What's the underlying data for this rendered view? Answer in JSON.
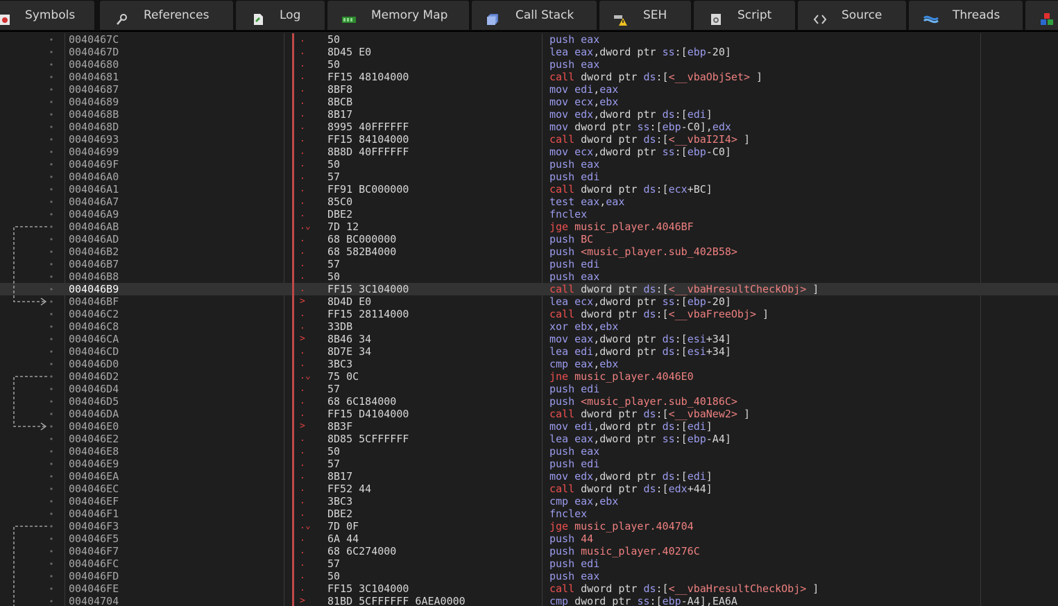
{
  "tabs": [
    {
      "label": "Symbols",
      "icon": "symbols-icon"
    },
    {
      "label": "References",
      "icon": "references-icon"
    },
    {
      "label": "Log",
      "icon": "log-icon"
    },
    {
      "label": "Memory Map",
      "icon": "memory-map-icon"
    },
    {
      "label": "Call Stack",
      "icon": "call-stack-icon"
    },
    {
      "label": "SEH",
      "icon": "seh-icon"
    },
    {
      "label": "Script",
      "icon": "script-icon"
    },
    {
      "label": "Source",
      "icon": "source-icon"
    },
    {
      "label": "Threads",
      "icon": "threads-icon"
    },
    {
      "label": "",
      "icon": "handles-icon"
    }
  ],
  "colors": {
    "background": "#1e1e1e",
    "mnemonic": "#9c9cf0",
    "call_jump": "#f05050",
    "symbol": "#f08080",
    "text": "#d8d8d8",
    "address": "#a8a8a8",
    "selected_row": "#333333",
    "eip_bar": "#c04848"
  },
  "disassembly": [
    {
      "addr": "0040467C",
      "mark": ".",
      "bytes": "50",
      "instr": [
        [
          "mn",
          "push "
        ],
        [
          "reg",
          "eax"
        ]
      ]
    },
    {
      "addr": "0040467D",
      "mark": ".",
      "bytes": "8D45 E0",
      "instr": [
        [
          "mn",
          "lea "
        ],
        [
          "reg",
          "eax"
        ],
        [
          "txt",
          ",dword ptr "
        ],
        [
          "seg",
          "ss"
        ],
        [
          "txt",
          ":["
        ],
        [
          "reg",
          "ebp"
        ],
        [
          "txt",
          "-20]"
        ]
      ]
    },
    {
      "addr": "00404680",
      "mark": ".",
      "bytes": "50",
      "instr": [
        [
          "mn",
          "push "
        ],
        [
          "reg",
          "eax"
        ]
      ]
    },
    {
      "addr": "00404681",
      "mark": ".",
      "bytes": "FF15 48104000",
      "instr": [
        [
          "call",
          "call "
        ],
        [
          "txt",
          "dword ptr "
        ],
        [
          "seg",
          "ds"
        ],
        [
          "txt",
          ":["
        ],
        [
          "sym",
          "<__vbaObjSet>"
        ],
        [
          "txt",
          " ]"
        ]
      ]
    },
    {
      "addr": "00404687",
      "mark": ".",
      "bytes": "8BF8",
      "instr": [
        [
          "mn",
          "mov "
        ],
        [
          "reg",
          "edi"
        ],
        [
          "txt",
          ","
        ],
        [
          "reg",
          "eax"
        ]
      ]
    },
    {
      "addr": "00404689",
      "mark": ".",
      "bytes": "8BCB",
      "instr": [
        [
          "mn",
          "mov "
        ],
        [
          "reg",
          "ecx"
        ],
        [
          "txt",
          ","
        ],
        [
          "reg",
          "ebx"
        ]
      ]
    },
    {
      "addr": "0040468B",
      "mark": ".",
      "bytes": "8B17",
      "instr": [
        [
          "mn",
          "mov "
        ],
        [
          "reg",
          "edx"
        ],
        [
          "txt",
          ",dword ptr "
        ],
        [
          "seg",
          "ds"
        ],
        [
          "txt",
          ":["
        ],
        [
          "reg",
          "edi"
        ],
        [
          "txt",
          "]"
        ]
      ]
    },
    {
      "addr": "0040468D",
      "mark": ".",
      "bytes": "8995 40FFFFFF",
      "instr": [
        [
          "mn",
          "mov "
        ],
        [
          "txt",
          "dword ptr "
        ],
        [
          "seg",
          "ss"
        ],
        [
          "txt",
          ":["
        ],
        [
          "reg",
          "ebp"
        ],
        [
          "txt",
          "-C0],"
        ],
        [
          "reg",
          "edx"
        ]
      ]
    },
    {
      "addr": "00404693",
      "mark": ".",
      "bytes": "FF15 84104000",
      "instr": [
        [
          "call",
          "call "
        ],
        [
          "txt",
          "dword ptr "
        ],
        [
          "seg",
          "ds"
        ],
        [
          "txt",
          ":["
        ],
        [
          "sym",
          "<__vbaI2I4>"
        ],
        [
          "txt",
          " ]"
        ]
      ]
    },
    {
      "addr": "00404699",
      "mark": ".",
      "bytes": "8B8D 40FFFFFF",
      "instr": [
        [
          "mn",
          "mov "
        ],
        [
          "reg",
          "ecx"
        ],
        [
          "txt",
          ",dword ptr "
        ],
        [
          "seg",
          "ss"
        ],
        [
          "txt",
          ":["
        ],
        [
          "reg",
          "ebp"
        ],
        [
          "txt",
          "-C0]"
        ]
      ]
    },
    {
      "addr": "0040469F",
      "mark": ".",
      "bytes": "50",
      "instr": [
        [
          "mn",
          "push "
        ],
        [
          "reg",
          "eax"
        ]
      ]
    },
    {
      "addr": "004046A0",
      "mark": ".",
      "bytes": "57",
      "instr": [
        [
          "mn",
          "push "
        ],
        [
          "reg",
          "edi"
        ]
      ]
    },
    {
      "addr": "004046A1",
      "mark": ".",
      "bytes": "FF91 BC000000",
      "instr": [
        [
          "call",
          "call "
        ],
        [
          "txt",
          "dword ptr "
        ],
        [
          "seg",
          "ds"
        ],
        [
          "txt",
          ":["
        ],
        [
          "reg",
          "ecx"
        ],
        [
          "txt",
          "+BC]"
        ]
      ]
    },
    {
      "addr": "004046A7",
      "mark": ".",
      "bytes": "85C0",
      "instr": [
        [
          "mn",
          "test "
        ],
        [
          "reg",
          "eax"
        ],
        [
          "txt",
          ","
        ],
        [
          "reg",
          "eax"
        ]
      ]
    },
    {
      "addr": "004046A9",
      "mark": ".",
      "bytes": "DBE2",
      "instr": [
        [
          "mn",
          "fnclex"
        ]
      ]
    },
    {
      "addr": "004046AB",
      "mark": ".⌄",
      "bytes": "7D 12",
      "instr": [
        [
          "jmp",
          "jge "
        ],
        [
          "sym",
          "music_player.4046BF"
        ]
      ]
    },
    {
      "addr": "004046AD",
      "mark": ".",
      "bytes": "68 BC000000",
      "instr": [
        [
          "mn",
          "push "
        ],
        [
          "sym",
          "BC"
        ]
      ]
    },
    {
      "addr": "004046B2",
      "mark": ".",
      "bytes": "68 582B4000",
      "instr": [
        [
          "mn",
          "push "
        ],
        [
          "sym",
          "<music_player.sub_402B58>"
        ]
      ]
    },
    {
      "addr": "004046B7",
      "mark": ".",
      "bytes": "57",
      "instr": [
        [
          "mn",
          "push "
        ],
        [
          "reg",
          "edi"
        ]
      ]
    },
    {
      "addr": "004046B8",
      "mark": ".",
      "bytes": "50",
      "instr": [
        [
          "mn",
          "push "
        ],
        [
          "reg",
          "eax"
        ]
      ]
    },
    {
      "addr": "004046B9",
      "mark": ".",
      "bytes": "FF15 3C104000",
      "sel": true,
      "instr": [
        [
          "call",
          "call "
        ],
        [
          "txt",
          "dword ptr "
        ],
        [
          "seg",
          "ds"
        ],
        [
          "txt",
          ":["
        ],
        [
          "sym",
          "<__vbaHresultCheckObj>"
        ],
        [
          "txt",
          " ]"
        ]
      ]
    },
    {
      "addr": "004046BF",
      "mark": ">",
      "bytes": "8D4D E0",
      "instr": [
        [
          "mn",
          "lea "
        ],
        [
          "reg",
          "ecx"
        ],
        [
          "txt",
          ",dword ptr "
        ],
        [
          "seg",
          "ss"
        ],
        [
          "txt",
          ":["
        ],
        [
          "reg",
          "ebp"
        ],
        [
          "txt",
          "-20]"
        ]
      ]
    },
    {
      "addr": "004046C2",
      "mark": ".",
      "bytes": "FF15 28114000",
      "instr": [
        [
          "call",
          "call "
        ],
        [
          "txt",
          "dword ptr "
        ],
        [
          "seg",
          "ds"
        ],
        [
          "txt",
          ":["
        ],
        [
          "sym",
          "<__vbaFreeObj>"
        ],
        [
          "txt",
          " ]"
        ]
      ]
    },
    {
      "addr": "004046C8",
      "mark": ".",
      "bytes": "33DB",
      "instr": [
        [
          "mn",
          "xor "
        ],
        [
          "reg",
          "ebx"
        ],
        [
          "txt",
          ","
        ],
        [
          "reg",
          "ebx"
        ]
      ]
    },
    {
      "addr": "004046CA",
      "mark": ">",
      "bytes": "8B46 34",
      "instr": [
        [
          "mn",
          "mov "
        ],
        [
          "reg",
          "eax"
        ],
        [
          "txt",
          ",dword ptr "
        ],
        [
          "seg",
          "ds"
        ],
        [
          "txt",
          ":["
        ],
        [
          "reg",
          "esi"
        ],
        [
          "txt",
          "+34]"
        ]
      ]
    },
    {
      "addr": "004046CD",
      "mark": ".",
      "bytes": "8D7E 34",
      "instr": [
        [
          "mn",
          "lea "
        ],
        [
          "reg",
          "edi"
        ],
        [
          "txt",
          ",dword ptr "
        ],
        [
          "seg",
          "ds"
        ],
        [
          "txt",
          ":["
        ],
        [
          "reg",
          "esi"
        ],
        [
          "txt",
          "+34]"
        ]
      ]
    },
    {
      "addr": "004046D0",
      "mark": ".",
      "bytes": "3BC3",
      "instr": [
        [
          "mn",
          "cmp "
        ],
        [
          "reg",
          "eax"
        ],
        [
          "txt",
          ","
        ],
        [
          "reg",
          "ebx"
        ]
      ]
    },
    {
      "addr": "004046D2",
      "mark": ".⌄",
      "bytes": "75 0C",
      "instr": [
        [
          "jmp",
          "jne "
        ],
        [
          "sym",
          "music_player.4046E0"
        ]
      ]
    },
    {
      "addr": "004046D4",
      "mark": ".",
      "bytes": "57",
      "instr": [
        [
          "mn",
          "push "
        ],
        [
          "reg",
          "edi"
        ]
      ]
    },
    {
      "addr": "004046D5",
      "mark": ".",
      "bytes": "68 6C184000",
      "instr": [
        [
          "mn",
          "push "
        ],
        [
          "sym",
          "<music_player.sub_40186C>"
        ]
      ]
    },
    {
      "addr": "004046DA",
      "mark": ".",
      "bytes": "FF15 D4104000",
      "instr": [
        [
          "call",
          "call "
        ],
        [
          "txt",
          "dword ptr "
        ],
        [
          "seg",
          "ds"
        ],
        [
          "txt",
          ":["
        ],
        [
          "sym",
          "<__vbaNew2>"
        ],
        [
          "txt",
          " ]"
        ]
      ]
    },
    {
      "addr": "004046E0",
      "mark": ">",
      "bytes": "8B3F",
      "instr": [
        [
          "mn",
          "mov "
        ],
        [
          "reg",
          "edi"
        ],
        [
          "txt",
          ",dword ptr "
        ],
        [
          "seg",
          "ds"
        ],
        [
          "txt",
          ":["
        ],
        [
          "reg",
          "edi"
        ],
        [
          "txt",
          "]"
        ]
      ]
    },
    {
      "addr": "004046E2",
      "mark": ".",
      "bytes": "8D85 5CFFFFFF",
      "instr": [
        [
          "mn",
          "lea "
        ],
        [
          "reg",
          "eax"
        ],
        [
          "txt",
          ",dword ptr "
        ],
        [
          "seg",
          "ss"
        ],
        [
          "txt",
          ":["
        ],
        [
          "reg",
          "ebp"
        ],
        [
          "txt",
          "-A4]"
        ]
      ]
    },
    {
      "addr": "004046E8",
      "mark": ".",
      "bytes": "50",
      "instr": [
        [
          "mn",
          "push "
        ],
        [
          "reg",
          "eax"
        ]
      ]
    },
    {
      "addr": "004046E9",
      "mark": ".",
      "bytes": "57",
      "instr": [
        [
          "mn",
          "push "
        ],
        [
          "reg",
          "edi"
        ]
      ]
    },
    {
      "addr": "004046EA",
      "mark": ".",
      "bytes": "8B17",
      "instr": [
        [
          "mn",
          "mov "
        ],
        [
          "reg",
          "edx"
        ],
        [
          "txt",
          ",dword ptr "
        ],
        [
          "seg",
          "ds"
        ],
        [
          "txt",
          ":["
        ],
        [
          "reg",
          "edi"
        ],
        [
          "txt",
          "]"
        ]
      ]
    },
    {
      "addr": "004046EC",
      "mark": ".",
      "bytes": "FF52 44",
      "instr": [
        [
          "call",
          "call "
        ],
        [
          "txt",
          "dword ptr "
        ],
        [
          "seg",
          "ds"
        ],
        [
          "txt",
          ":["
        ],
        [
          "reg",
          "edx"
        ],
        [
          "txt",
          "+44]"
        ]
      ]
    },
    {
      "addr": "004046EF",
      "mark": ".",
      "bytes": "3BC3",
      "instr": [
        [
          "mn",
          "cmp "
        ],
        [
          "reg",
          "eax"
        ],
        [
          "txt",
          ","
        ],
        [
          "reg",
          "ebx"
        ]
      ]
    },
    {
      "addr": "004046F1",
      "mark": ".",
      "bytes": "DBE2",
      "instr": [
        [
          "mn",
          "fnclex"
        ]
      ]
    },
    {
      "addr": "004046F3",
      "mark": ".⌄",
      "bytes": "7D 0F",
      "instr": [
        [
          "jmp",
          "jge "
        ],
        [
          "sym",
          "music_player.404704"
        ]
      ]
    },
    {
      "addr": "004046F5",
      "mark": ".",
      "bytes": "6A 44",
      "instr": [
        [
          "mn",
          "push "
        ],
        [
          "sym",
          "44"
        ]
      ]
    },
    {
      "addr": "004046F7",
      "mark": ".",
      "bytes": "68 6C274000",
      "instr": [
        [
          "mn",
          "push "
        ],
        [
          "sym",
          "music_player.40276C"
        ]
      ]
    },
    {
      "addr": "004046FC",
      "mark": ".",
      "bytes": "57",
      "instr": [
        [
          "mn",
          "push "
        ],
        [
          "reg",
          "edi"
        ]
      ]
    },
    {
      "addr": "004046FD",
      "mark": ".",
      "bytes": "50",
      "instr": [
        [
          "mn",
          "push "
        ],
        [
          "reg",
          "eax"
        ]
      ]
    },
    {
      "addr": "004046FE",
      "mark": ".",
      "bytes": "FF15 3C104000",
      "instr": [
        [
          "call",
          "call "
        ],
        [
          "txt",
          "dword ptr "
        ],
        [
          "seg",
          "ds"
        ],
        [
          "txt",
          ":["
        ],
        [
          "sym",
          "<__vbaHresultCheckObj>"
        ],
        [
          "txt",
          " ]"
        ]
      ]
    },
    {
      "addr": "00404704",
      "mark": ">",
      "bytes": "81BD 5CFFFFFF 6AEA0000",
      "instr": [
        [
          "mn",
          "cmp "
        ],
        [
          "txt",
          "dword ptr "
        ],
        [
          "seg",
          "ss"
        ],
        [
          "txt",
          ":["
        ],
        [
          "reg",
          "ebp"
        ],
        [
          "txt",
          "-A4],"
        ],
        [
          "num",
          "EA6A"
        ]
      ]
    }
  ],
  "jumps": [
    {
      "from": 15,
      "to": 21
    },
    {
      "from": 27,
      "to": 31
    },
    {
      "from": 39,
      "to": 46
    }
  ]
}
